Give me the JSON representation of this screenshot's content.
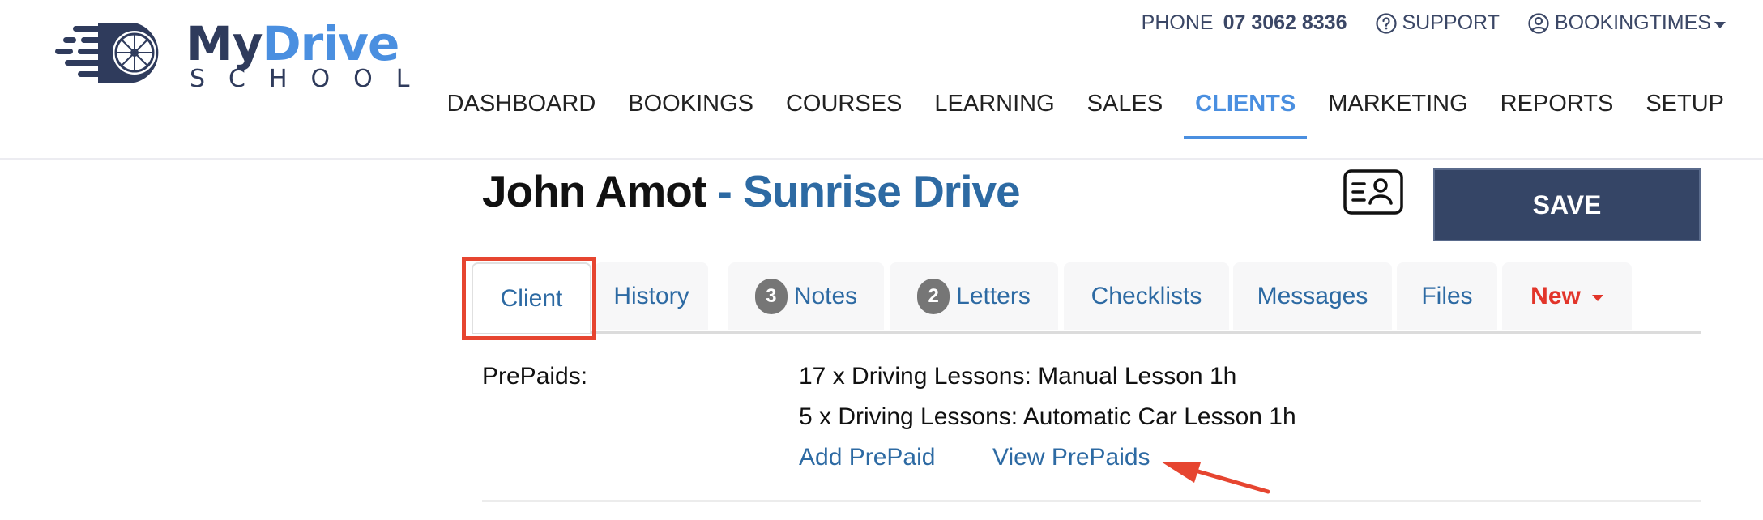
{
  "brand": {
    "name_part1": "My",
    "name_part2": "Drive",
    "tagline": "SCHOOL",
    "colors": {
      "dark": "#2f3b5c",
      "accent": "#4a8fe0"
    }
  },
  "topbar": {
    "phone_label": "PHONE",
    "phone_number": "07 3062 8336",
    "support_label": "SUPPORT",
    "account_label": "BOOKINGTIMES"
  },
  "nav": {
    "items": [
      {
        "label": "DASHBOARD"
      },
      {
        "label": "BOOKINGS"
      },
      {
        "label": "COURSES"
      },
      {
        "label": "LEARNING"
      },
      {
        "label": "SALES"
      },
      {
        "label": "CLIENTS",
        "active": true
      },
      {
        "label": "MARKETING"
      },
      {
        "label": "REPORTS"
      },
      {
        "label": "SETUP"
      }
    ]
  },
  "page": {
    "client_name": "John Amot",
    "separator": "-",
    "location": "Sunrise Drive",
    "save_label": "SAVE"
  },
  "tabs": [
    {
      "label": "Client",
      "active": true
    },
    {
      "label": "History"
    },
    {
      "label": "Notes",
      "badge": "3"
    },
    {
      "label": "Letters",
      "badge": "2"
    },
    {
      "label": "Checklists"
    },
    {
      "label": "Messages"
    },
    {
      "label": "Files"
    },
    {
      "label": "New",
      "dropdown": true
    }
  ],
  "prepaids": {
    "label": "PrePaids:",
    "items": [
      "17 x Driving Lessons: Manual Lesson 1h",
      "5 x Driving Lessons: Automatic Car Lesson 1h"
    ],
    "add_link": "Add PrePaid",
    "view_link": "View PrePaids"
  },
  "annotation_color": "#e64530"
}
